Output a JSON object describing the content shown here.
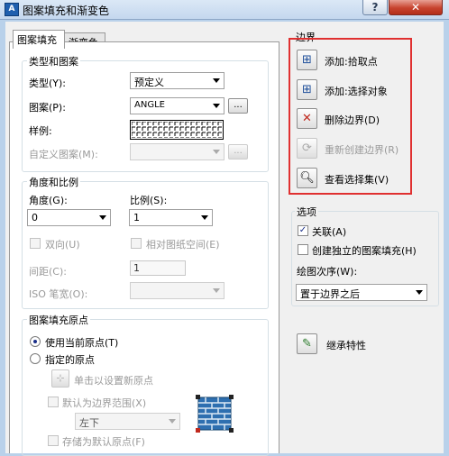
{
  "window": {
    "title": "图案填充和渐变色",
    "app_icon": "autocad-icon",
    "help_label": "?",
    "close_label": "✕"
  },
  "tabs": [
    "图案填充",
    "渐变色"
  ],
  "type_pattern": {
    "group_label": "类型和图案",
    "type_label": "类型(Y):",
    "type_value": "预定义",
    "pattern_label": "图案(P):",
    "pattern_value": "ANGLE",
    "pattern_ellipsis": "...",
    "swatch_label": "样例:",
    "custom_label": "自定义图案(M):",
    "custom_ellipsis": "..."
  },
  "angle_scale": {
    "group_label": "角度和比例",
    "angle_label": "角度(G):",
    "angle_value": "0",
    "scale_label": "比例(S):",
    "scale_value": "1",
    "double_label": "双向(U)",
    "relative_label": "相对图纸空间(E)",
    "spacing_label": "间距(C):",
    "spacing_value": "1",
    "iso_label": "ISO 笔宽(O):"
  },
  "origin": {
    "group_label": "图案填充原点",
    "use_current_label": "使用当前原点(T)",
    "specified_label": "指定的原点",
    "click_label": "单击以设置新原点",
    "default_extent_label": "默认为边界范围(X)",
    "position_value": "左下",
    "store_label": "存储为默认原点(F)"
  },
  "boundaries": {
    "group_label": "边界",
    "add_pick_label": "添加:拾取点",
    "add_select_label": "添加:选择对象",
    "remove_label": "删除边界(D)",
    "recreate_label": "重新创建边界(R)",
    "view_label": "查看选择集(V)"
  },
  "options": {
    "group_label": "选项",
    "associative_label": "关联(A)",
    "associative_checked": true,
    "separate_label": "创建独立的图案填充(H)",
    "draw_order_label": "绘图次序(W):",
    "draw_order_value": "置于边界之后"
  },
  "inherit": {
    "label": "继承特性"
  },
  "colors": {
    "highlight": "#e03030",
    "title_bar": "#c4d7ee",
    "close": "#c7432e"
  }
}
